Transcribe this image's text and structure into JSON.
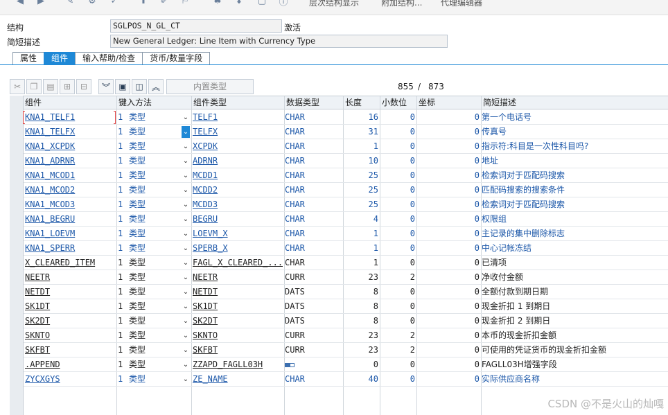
{
  "toolbar": {
    "labels": [
      "层次结构显示",
      "附加结构...",
      "代理编辑器"
    ]
  },
  "header": {
    "structure_label": "结构",
    "structure_value": "SGLPOS_N_GL_CT",
    "status": "激活",
    "desc_label": "简短描述",
    "desc_value": "New General Ledger: Line Item with Currency Type"
  },
  "tabs": [
    {
      "label": "属性",
      "active": false
    },
    {
      "label": "组件",
      "active": true
    },
    {
      "label": "输入帮助/检查",
      "active": false
    },
    {
      "label": "货币/数量字段",
      "active": false
    }
  ],
  "grid_toolbar": {
    "builtin_type_label": "内置类型",
    "current": "855",
    "separator": "/",
    "total": "873"
  },
  "columns": {
    "component": "组件",
    "input_method": "键入方法",
    "component_type": "组件类型",
    "data_type": "数据类型",
    "length": "长度",
    "decimals": "小数位",
    "coordinate": "坐标",
    "short_desc": "简短描述"
  },
  "rows": [
    {
      "comp": "KNA1_TELF1",
      "n": "1",
      "method": "类型",
      "ctype": "TELF1",
      "dtype": "CHAR",
      "len": "16",
      "dec": "0",
      "coord": "0",
      "desc": "第一个电话号",
      "blue": true
    },
    {
      "comp": "KNA1_TELFX",
      "n": "1",
      "method": "类型",
      "ctype": "TELFX",
      "dtype": "CHAR",
      "len": "31",
      "dec": "0",
      "coord": "0",
      "desc": "传真号",
      "blue": true
    },
    {
      "comp": "KNA1_XCPDK",
      "n": "1",
      "method": "类型",
      "ctype": "XCPDK",
      "dtype": "CHAR",
      "len": "1",
      "dec": "0",
      "coord": "0",
      "desc": "指示符:科目是一次性科目吗?",
      "blue": true
    },
    {
      "comp": "KNA1_ADRNR",
      "n": "1",
      "method": "类型",
      "ctype": "ADRNR",
      "dtype": "CHAR",
      "len": "10",
      "dec": "0",
      "coord": "0",
      "desc": "地址",
      "blue": true
    },
    {
      "comp": "KNA1_MCOD1",
      "n": "1",
      "method": "类型",
      "ctype": "MCDD1",
      "dtype": "CHAR",
      "len": "25",
      "dec": "0",
      "coord": "0",
      "desc": "检索词对于匹配码搜索",
      "blue": true
    },
    {
      "comp": "KNA1_MCOD2",
      "n": "1",
      "method": "类型",
      "ctype": "MCDD2",
      "dtype": "CHAR",
      "len": "25",
      "dec": "0",
      "coord": "0",
      "desc": "匹配码搜索的搜索条件",
      "blue": true
    },
    {
      "comp": "KNA1_MCOD3",
      "n": "1",
      "method": "类型",
      "ctype": "MCDD3",
      "dtype": "CHAR",
      "len": "25",
      "dec": "0",
      "coord": "0",
      "desc": "检索词对于匹配码搜索",
      "blue": true
    },
    {
      "comp": "KNA1_BEGRU",
      "n": "1",
      "method": "类型",
      "ctype": "BEGRU",
      "dtype": "CHAR",
      "len": "4",
      "dec": "0",
      "coord": "0",
      "desc": "权限组",
      "blue": true
    },
    {
      "comp": "KNA1_LOEVM",
      "n": "1",
      "method": "类型",
      "ctype": "LOEVM_X",
      "dtype": "CHAR",
      "len": "1",
      "dec": "0",
      "coord": "0",
      "desc": "主记录的集中删除标志",
      "blue": true
    },
    {
      "comp": "KNA1_SPERR",
      "n": "1",
      "method": "类型",
      "ctype": "SPERB_X",
      "dtype": "CHAR",
      "len": "1",
      "dec": "0",
      "coord": "0",
      "desc": "中心记帐冻结",
      "blue": true
    },
    {
      "comp": "X_CLEARED_ITEM",
      "n": "1",
      "method": "类型",
      "ctype": "FAGL_X_CLEARED_...",
      "dtype": "CHAR",
      "len": "1",
      "dec": "0",
      "coord": "0",
      "desc": "已清项",
      "blue": false
    },
    {
      "comp": "NEETR",
      "n": "1",
      "method": "类型",
      "ctype": "NEETR",
      "dtype": "CURR",
      "len": "23",
      "dec": "2",
      "coord": "0",
      "desc": "净收付金额",
      "blue": false
    },
    {
      "comp": "NETDT",
      "n": "1",
      "method": "类型",
      "ctype": "NETDT",
      "dtype": "DATS",
      "len": "8",
      "dec": "0",
      "coord": "0",
      "desc": "全额付款到期日期",
      "blue": false
    },
    {
      "comp": "SK1DT",
      "n": "1",
      "method": "类型",
      "ctype": "SK1DT",
      "dtype": "DATS",
      "len": "8",
      "dec": "0",
      "coord": "0",
      "desc": "现金折扣 1 到期日",
      "blue": false
    },
    {
      "comp": "SK2DT",
      "n": "1",
      "method": "类型",
      "ctype": "SK2DT",
      "dtype": "DATS",
      "len": "8",
      "dec": "0",
      "coord": "0",
      "desc": "现金折扣 2 到期日",
      "blue": false
    },
    {
      "comp": "SKNTO",
      "n": "1",
      "method": "类型",
      "ctype": "SKNTO",
      "dtype": "CURR",
      "len": "23",
      "dec": "2",
      "coord": "0",
      "desc": "本币的现金折扣金额",
      "blue": false
    },
    {
      "comp": "SKFBT",
      "n": "1",
      "method": "类型",
      "ctype": "SKFBT",
      "dtype": "CURR",
      "len": "23",
      "dec": "2",
      "coord": "0",
      "desc": "可使用的凭证货币的现金折扣金额",
      "blue": false
    },
    {
      "comp": ".APPEND",
      "n": "1",
      "method": "类型",
      "ctype": "ZZAPD_FAGLL03H",
      "dtype": "",
      "len": "0",
      "dec": "0",
      "coord": "0",
      "desc": "FAGLL03H增强字段",
      "blue": false,
      "struct_icon": true
    },
    {
      "comp": "ZYCXGYS",
      "n": "1",
      "method": "类型",
      "ctype": "ZE_NAME",
      "dtype": "CHAR",
      "len": "40",
      "dec": "0",
      "coord": "0",
      "desc": "实际供应商名称",
      "blue": true
    }
  ],
  "watermark": "CSDN @不是火山的灿嘎"
}
